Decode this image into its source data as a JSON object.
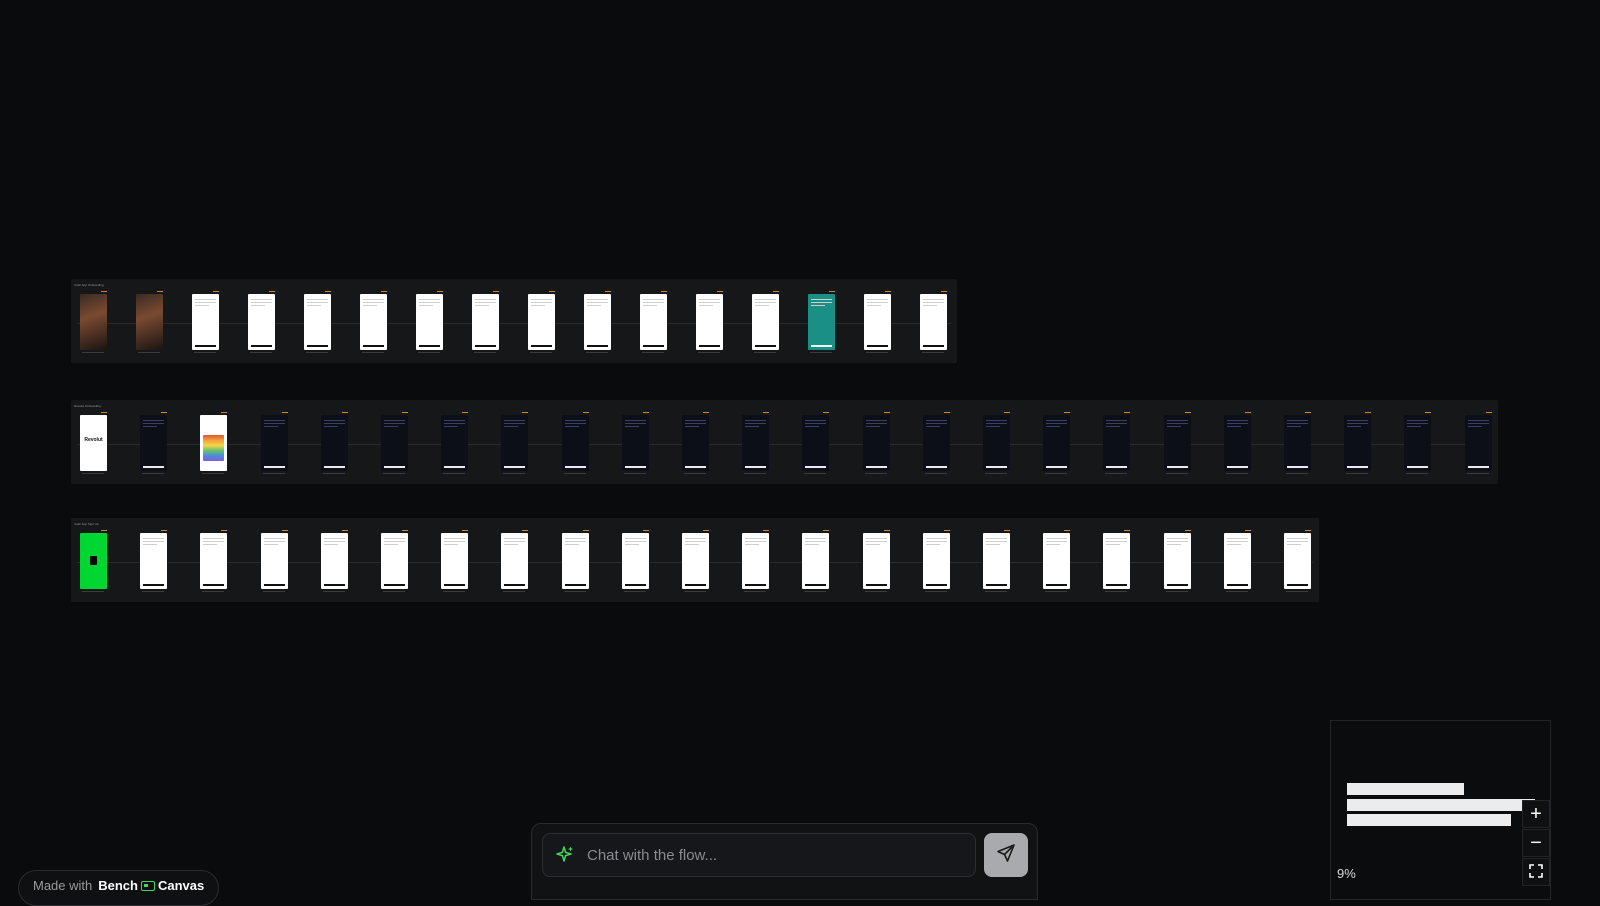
{
  "flows": [
    {
      "title": "Cash App Onboarding",
      "screen_count": 16,
      "screens": [
        "dark-photo",
        "dark-photo",
        "light",
        "light",
        "light",
        "light",
        "light",
        "light",
        "light",
        "light",
        "light",
        "light",
        "light",
        "teal",
        "light",
        "light"
      ]
    },
    {
      "title": "Revolut Onboarding",
      "screen_count": 24,
      "logo_text": "Revolut",
      "screens": [
        "light-logo",
        "dark",
        "light-rainbow",
        "dark",
        "dark",
        "dark",
        "dark",
        "dark",
        "dark",
        "dark",
        "dark",
        "dark",
        "dark",
        "dark",
        "dark",
        "dark",
        "dark",
        "dark",
        "dark",
        "dark",
        "dark",
        "dark",
        "dark",
        "dark"
      ]
    },
    {
      "title": "Cash App Sign Up",
      "screen_count": 21,
      "screens": [
        "green",
        "light",
        "light",
        "light",
        "light",
        "light",
        "light",
        "light",
        "light",
        "light",
        "light",
        "light",
        "light",
        "light",
        "light",
        "light",
        "light",
        "light",
        "light",
        "light",
        "light"
      ]
    }
  ],
  "badge": {
    "prefix": "Made with",
    "brand_left": "Bench",
    "brand_right": "Canvas"
  },
  "chat": {
    "placeholder": "Chat with the flow...",
    "send_icon": "send-icon",
    "spark_icon": "sparkles-icon"
  },
  "minimap": {
    "zoom_label": "9%",
    "zoom_in": "+",
    "zoom_out": "−"
  },
  "colors": {
    "background": "#0a0b0d",
    "panel": "#161719",
    "accent_green": "#46d45a",
    "tag": "#c98b1a",
    "teal": "#1a8f85",
    "cash_green": "#00d632"
  }
}
